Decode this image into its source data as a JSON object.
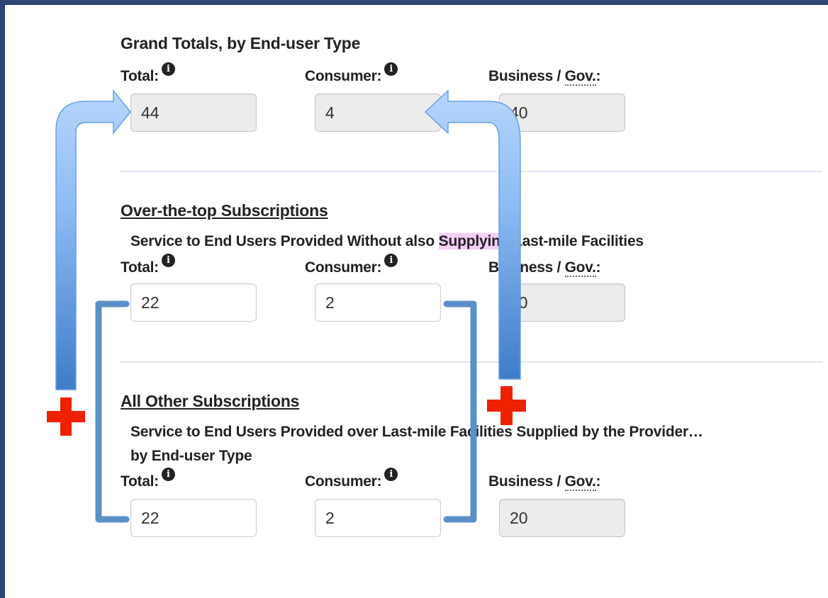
{
  "grand": {
    "heading": "Grand Totals, by End-user Type",
    "total_label": "Total:",
    "consumer_label": "Consumer:",
    "business_label_pre": "Business / ",
    "business_label_abbr": "Gov.",
    "business_label_post": ":",
    "total_value": "44",
    "consumer_value": "4",
    "business_value": "40"
  },
  "ott": {
    "heading": "Over-the-top Subscriptions",
    "desc_pre": "Service to End Users Provided Without also ",
    "desc_highlight": "Supplying",
    "desc_post": " Last-mile Facilities",
    "total_label": "Total:",
    "consumer_label": "Consumer:",
    "business_label_pre": "Business / ",
    "business_label_abbr": "Gov.",
    "business_label_post": ":",
    "total_value": "22",
    "consumer_value": "2",
    "business_value": "20"
  },
  "other": {
    "heading": "All Other Subscriptions",
    "desc_line1": "Service to End Users Provided over Last-mile Facilities Supplied by the Provider…",
    "desc_line2": "by End-user Type",
    "total_label": "Total:",
    "consumer_label": "Consumer:",
    "business_label_pre": "Business / ",
    "business_label_abbr": "Gov.",
    "business_label_post": ":",
    "total_value": "22",
    "consumer_value": "2",
    "business_value": "20"
  },
  "icons": {
    "info": "info-icon",
    "plus": "plus-icon",
    "arrow": "up-arrow-icon"
  },
  "colors": {
    "arrow_top": "#a9cdfb",
    "arrow_bottom": "#4a86d0",
    "bracket": "#5b8fc7",
    "plus": "#ee2200",
    "frame": "#2d4673"
  },
  "info_glyph": "i"
}
